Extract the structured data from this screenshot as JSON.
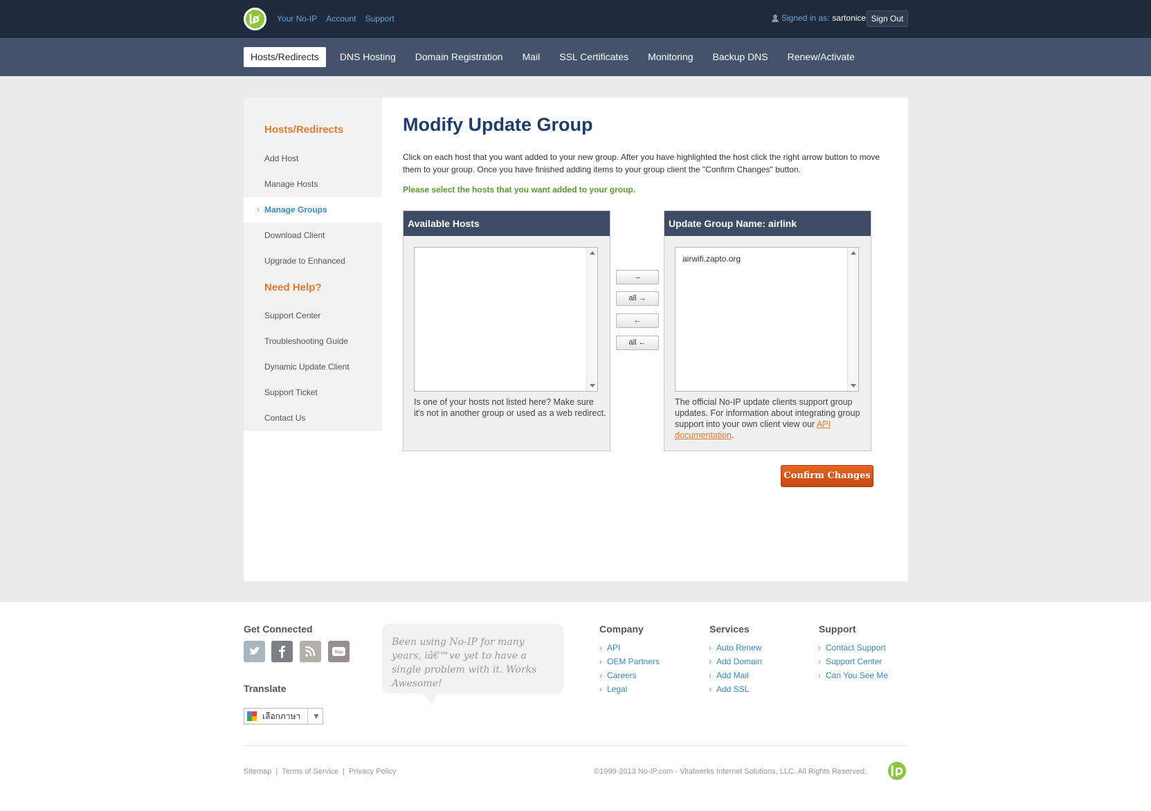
{
  "header": {
    "links": [
      "Your No-IP",
      "Account",
      "Support"
    ],
    "signed_in_label": "Signed in as:",
    "username": "sartonice",
    "sign_out": "Sign Out"
  },
  "nav": {
    "items": [
      "Hosts/Redirects",
      "DNS Hosting",
      "Domain Registration",
      "Mail",
      "SSL Certificates",
      "Monitoring",
      "Backup DNS",
      "Renew/Activate"
    ],
    "active": "Hosts/Redirects"
  },
  "sidebar": {
    "section1_title": "Hosts/Redirects",
    "section1_items": [
      "Add Host",
      "Manage Hosts",
      "Manage Groups",
      "Download Client",
      "Upgrade to Enhanced"
    ],
    "active_item": "Manage Groups",
    "section2_title": "Need Help?",
    "section2_items": [
      "Support Center",
      "Troubleshooting Guide",
      "Dynamic Update Client",
      "Support Ticket",
      "Contact Us"
    ]
  },
  "main": {
    "title": "Modify Update Group",
    "intro": "Click on each host that you want added to your new group. After you have highlighted the host click the right arrow button to move them to your group. Once you have finished adding items to your group client the \"Confirm Changes\" button.",
    "notice": "Please select the hosts that you want added to your group.",
    "available": {
      "title": "Available Hosts",
      "items": [],
      "note": "Is one of your hosts not listed here? Make sure it's not in another group or used as a web redirect."
    },
    "group": {
      "title": "Update Group Name: airlink",
      "items": [
        "airwifi.zapto.org"
      ],
      "note_prefix": "The official No-IP update clients support group updates. For information about integrating group support into your own client view our ",
      "note_link": "API documentation",
      "note_suffix": "."
    },
    "move_buttons": [
      "→",
      "all →",
      "←",
      "all ←"
    ],
    "confirm": "Confirm Changes"
  },
  "footer": {
    "get_connected": "Get Connected",
    "social": [
      "twitter-icon",
      "facebook-icon",
      "rss-icon",
      "youtube-icon"
    ],
    "testimonial": "Been using No-IP for many years, iâ€™ve yet to have a single problem with it. Works Awesome!",
    "translate_title": "Translate",
    "translate_select": "เลือกภาษา",
    "company": {
      "title": "Company",
      "items": [
        "API",
        "OEM Partners",
        "Careers",
        "Legal"
      ]
    },
    "services": {
      "title": "Services",
      "items": [
        "Auto Renew",
        "Add Domain",
        "Add Mail",
        "Add SSL"
      ]
    },
    "support": {
      "title": "Support",
      "items": [
        "Contact Support",
        "Support Center",
        "Can You See Me"
      ]
    },
    "bottom_links": [
      "Sitemap",
      "Terms of Service",
      "Privacy Policy"
    ],
    "copyright": "©1999-2013 No-IP.com - Vitalwerks Internet Solutions, LLC. All Rights Reserved."
  },
  "colors": {
    "topbar": "#1f2b3c",
    "navbar": "#44526b",
    "accent_orange": "#e07b2e",
    "link_blue": "#3a87c8",
    "logo_green": "#8cc63f"
  }
}
